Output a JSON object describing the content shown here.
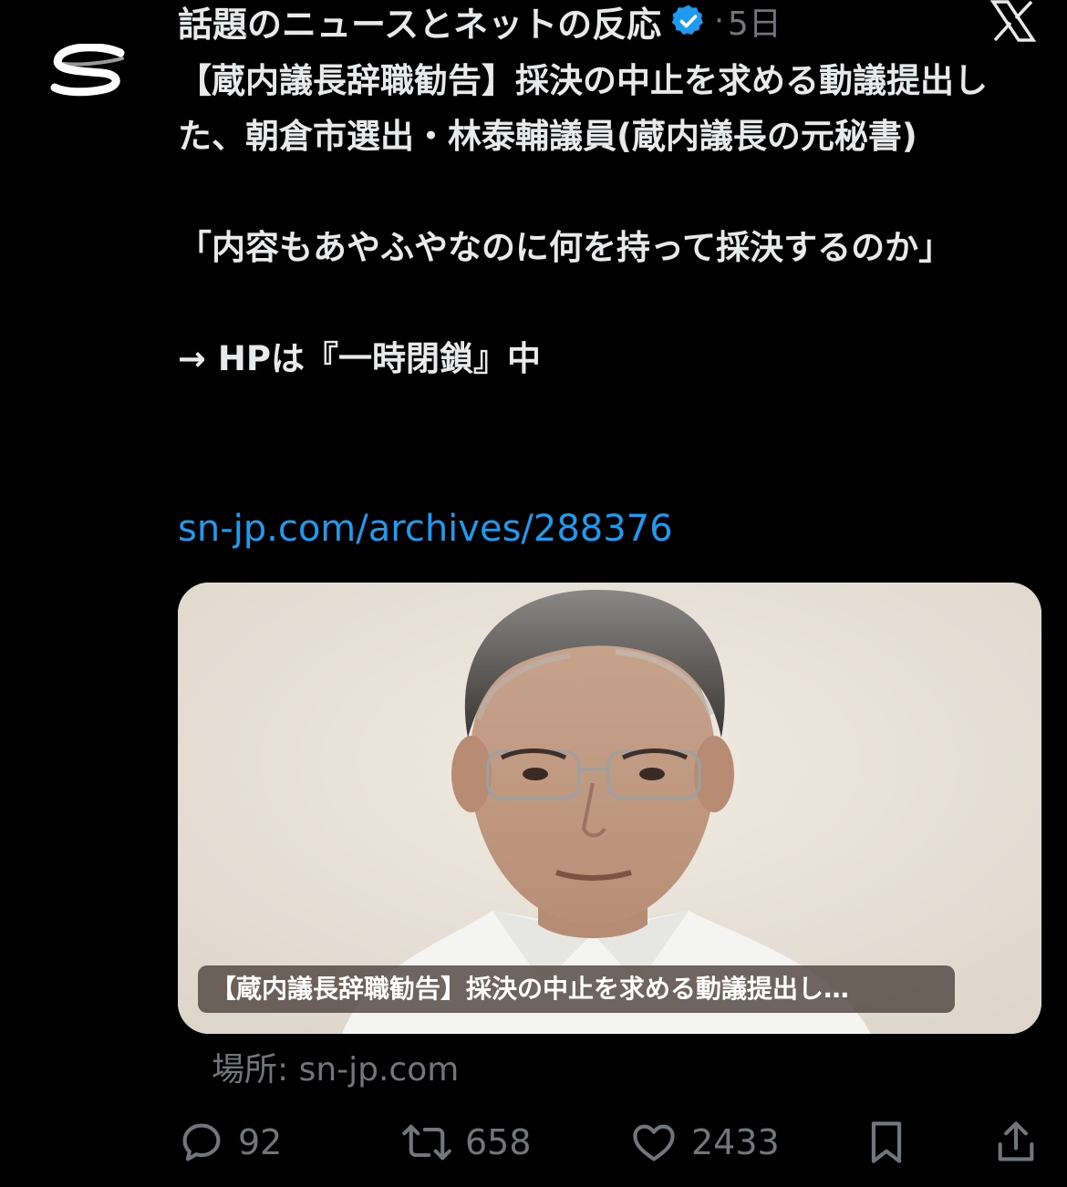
{
  "author": {
    "name": "話題のニュースとネットの反応",
    "verified": true,
    "avatar_icon": "snap-s-logo-icon"
  },
  "meta": {
    "separator": "·",
    "time": "5日"
  },
  "platform_icon": "x-logo-icon",
  "post": {
    "lines": [
      "【蔵内議長辞職勧告】採決の中止を求める動議提出した、朝倉市選出・林泰輔議員(蔵内議長の元秘書)",
      "「内容もあやふやなのに何を持って採決するのか」",
      "→ HPは『一時閉鎖』中"
    ],
    "link": "sn-jp.com/archives/288376"
  },
  "card": {
    "caption": "【蔵内議長辞職勧告】採決の中止を求める動議提出し…",
    "source": "場所: sn-jp.com"
  },
  "actions": {
    "replies": "92",
    "reposts": "658",
    "likes": "2433"
  },
  "colors": {
    "background": "#000000",
    "text": "#e7e9ea",
    "muted": "#71767b",
    "link": "#1d9bf0",
    "verified": "#1d9bf0"
  }
}
